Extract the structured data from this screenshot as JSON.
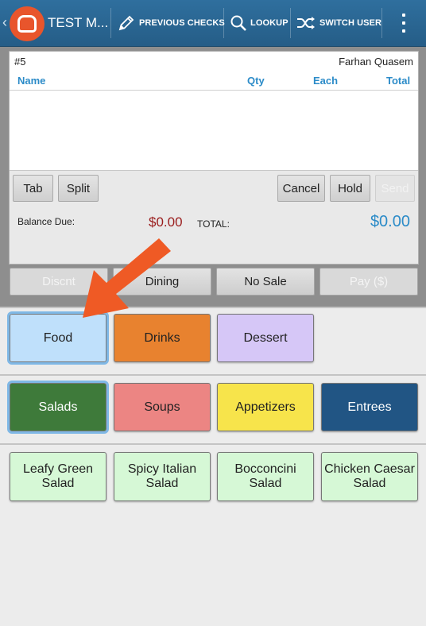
{
  "app": {
    "title": "TEST M..."
  },
  "actionbar": {
    "previous_checks": "PREVIOUS CHECKS",
    "lookup": "LOOKUP",
    "switch_user": "SWITCH USER"
  },
  "check": {
    "number": "#5",
    "server": "Farhan Quasem",
    "columns": {
      "name": "Name",
      "qty": "Qty",
      "each": "Each",
      "total": "Total"
    },
    "buttons": {
      "tab": "Tab",
      "split": "Split",
      "cancel": "Cancel",
      "hold": "Hold",
      "send": "Send"
    },
    "balance_label": "Balance Due:",
    "balance_value": "$0.00",
    "total_label": "TOTAL:",
    "total_value": "$0.00"
  },
  "actions": {
    "discount": "Discnt",
    "dining": "Dining",
    "no_sale": "No Sale",
    "pay": "Pay ($)"
  },
  "categories": [
    {
      "label": "Food",
      "color": "#bfe0fb",
      "selected": true
    },
    {
      "label": "Drinks",
      "color": "#e8822f"
    },
    {
      "label": "Dessert",
      "color": "#d6c7f7"
    }
  ],
  "subcategories": [
    {
      "label": "Salads",
      "color": "#3e7a3a",
      "text_color": "#ffffff",
      "selected": true
    },
    {
      "label": "Soups",
      "color": "#ec8583"
    },
    {
      "label": "Appetizers",
      "color": "#f7e44b"
    },
    {
      "label": "Entrees",
      "color": "#215584",
      "text_color": "#ffffff"
    }
  ],
  "items": [
    {
      "label": "Leafy Green Salad",
      "color": "#d6f8d6"
    },
    {
      "label": "Spicy Italian Salad",
      "color": "#d6f8d6"
    },
    {
      "label": "Bocconcini Salad",
      "color": "#d6f8d6"
    },
    {
      "label": "Chicken Caesar Salad",
      "color": "#d6f8d6"
    }
  ],
  "colors": {
    "accent": "#2b8bc8",
    "actionbar": "#2f6f9e",
    "arrow": "#ef5a25"
  }
}
